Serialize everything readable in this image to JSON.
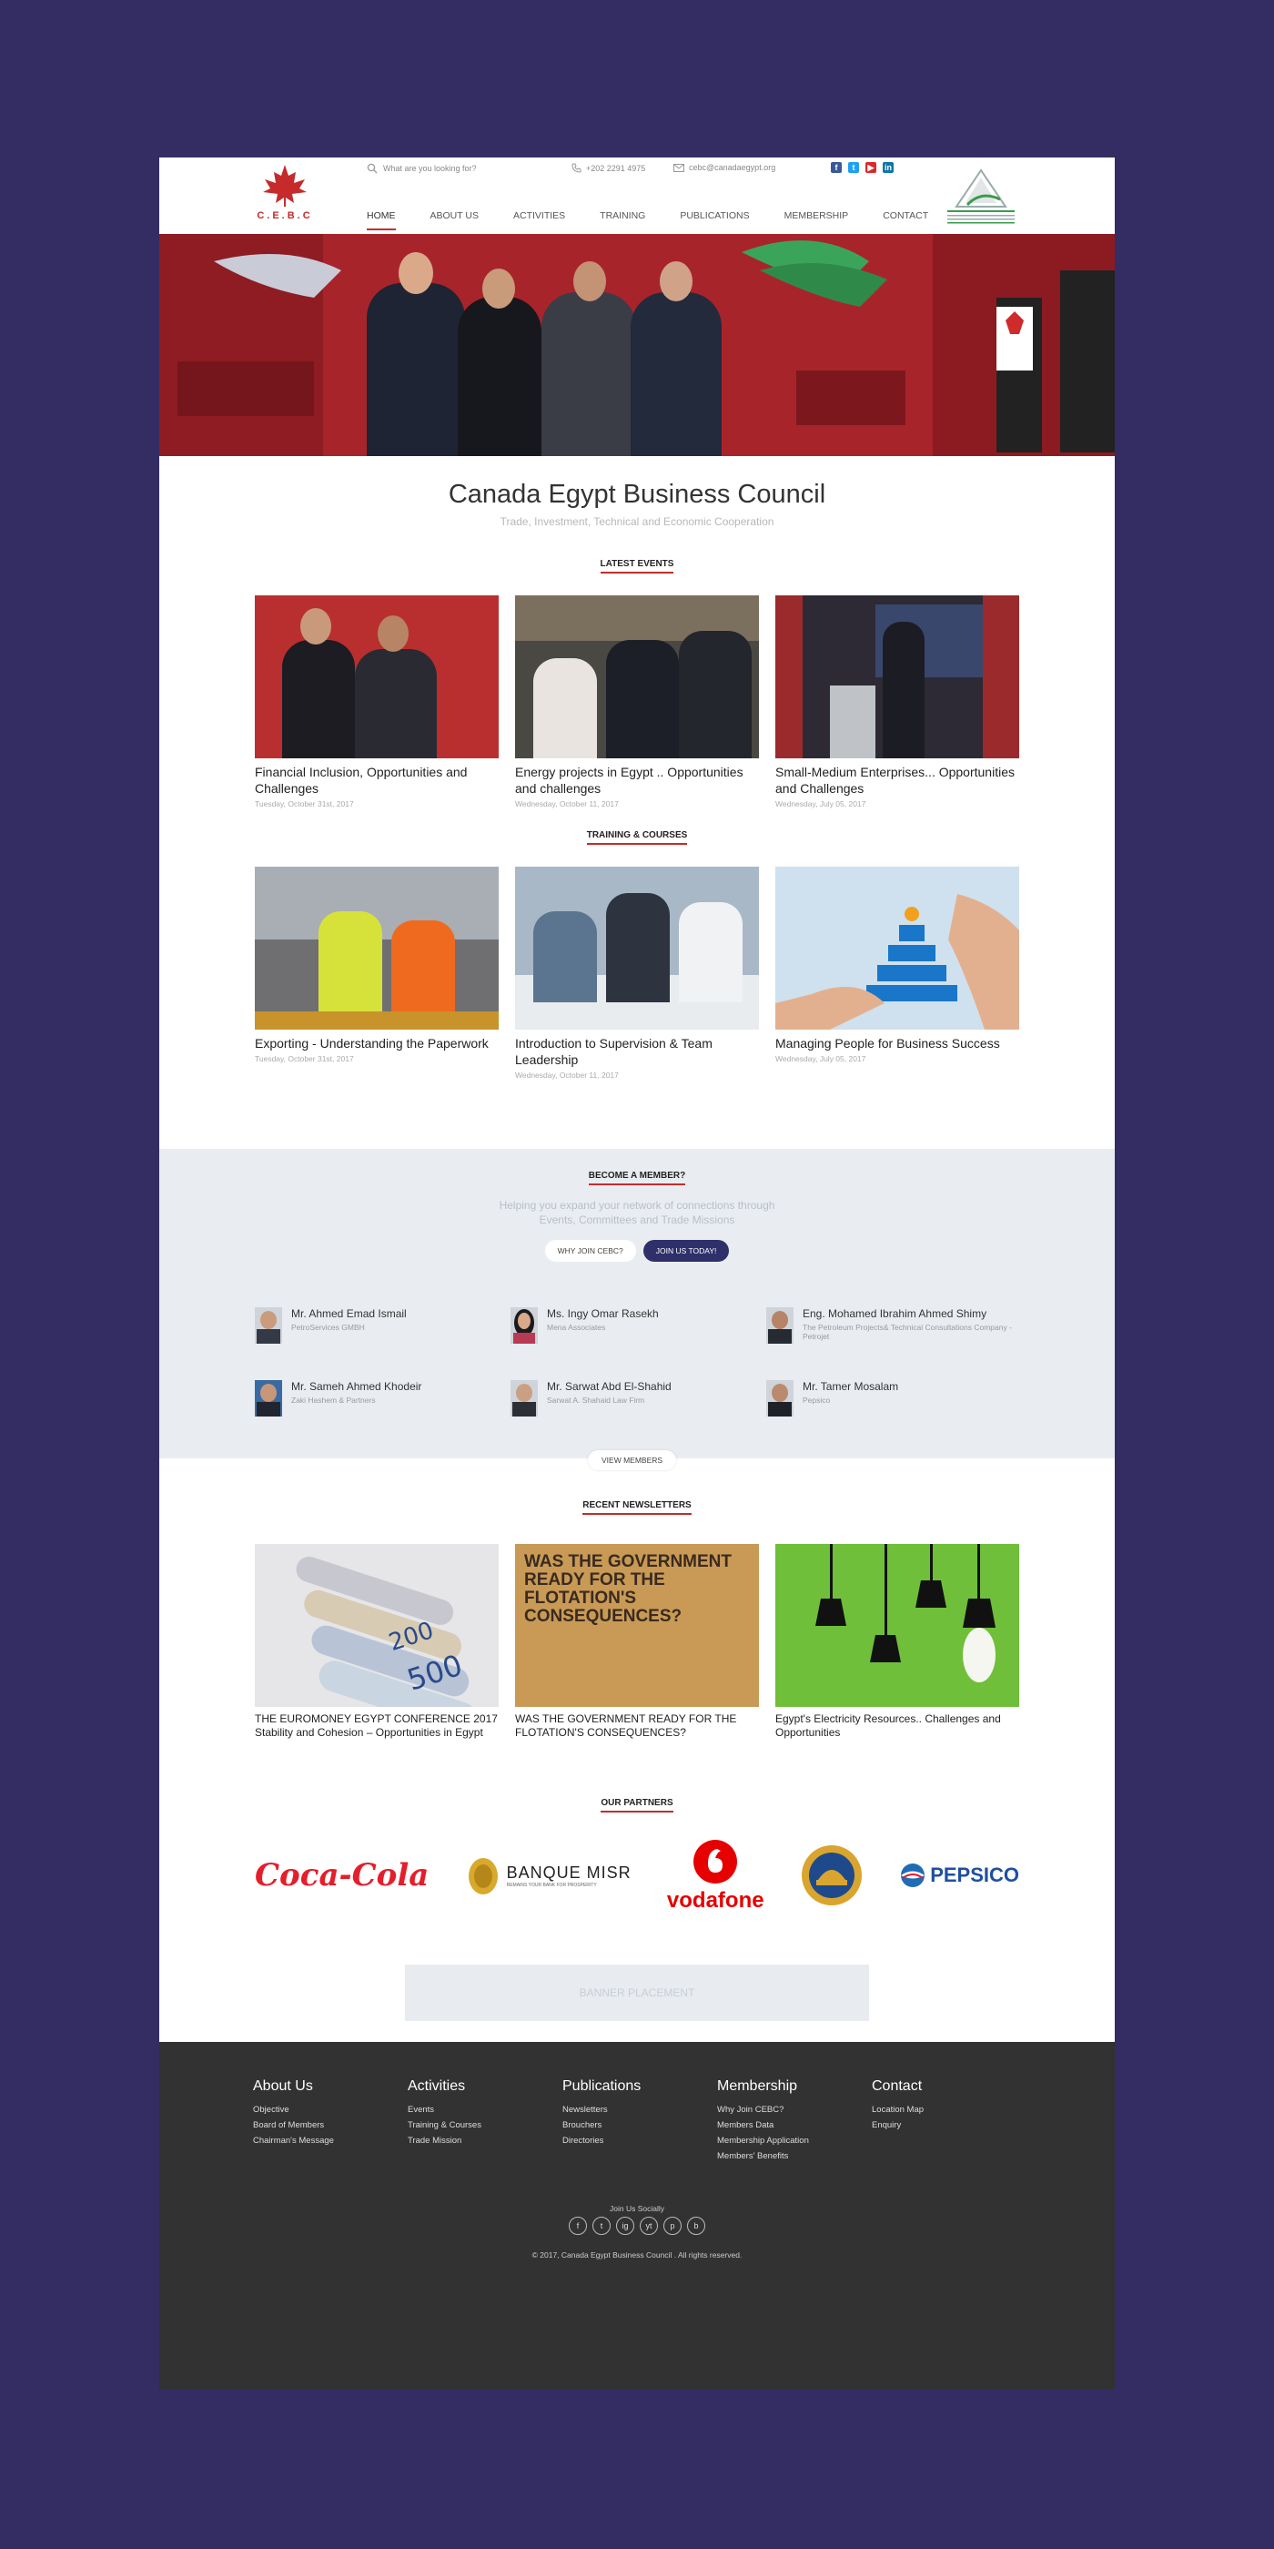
{
  "header": {
    "logo_text": "C.E.B.C",
    "search_placeholder": "What are you looking for?",
    "phone": "+202 2291 4975",
    "email": "cebc@canadaegypt.org",
    "social": [
      "facebook-icon",
      "twitter-icon",
      "youtube-icon",
      "linkedin-icon"
    ],
    "nav": [
      "HOME",
      "ABOUT US",
      "ACTIVITIES",
      "TRAINING",
      "PUBLICATIONS",
      "MEMBERSHIP",
      "CONTACT"
    ],
    "active_nav": "HOME",
    "accent": "#c62b2b"
  },
  "intro": {
    "title": "Canada Egypt Business Council",
    "subtitle": "Trade, Investment, Technical and Economic Cooperation"
  },
  "events": {
    "title": "LATEST EVENTS",
    "items": [
      {
        "title": "Financial Inclusion, Opportunities and Challenges",
        "date": "Tuesday, October 31st, 2017"
      },
      {
        "title": "Energy projects in Egypt .. Opportunities and challenges",
        "date": "Wednesday, October 11, 2017"
      },
      {
        "title": "Small-Medium Enterprises... Opportunities and Challenges",
        "date": "Wednesday, July 05, 2017"
      }
    ]
  },
  "training": {
    "title": "TRAINING & COURSES",
    "items": [
      {
        "title": "Exporting - Understanding the Paperwork",
        "date": "Tuesday, October 31st, 2017"
      },
      {
        "title": "Introduction to Supervision & Team Leadership",
        "date": "Wednesday, October 11, 2017"
      },
      {
        "title": "Managing People for Business Success",
        "date": "Wednesday, July 05, 2017"
      }
    ]
  },
  "membership": {
    "title": "BECOME A MEMBER?",
    "subtitle_1": "Helping you expand your network of connections through",
    "subtitle_2": "Events, Committees and Trade Missions",
    "why_button": "WHY JOIN CEBC?",
    "join_button": "JOIN US TODAY!",
    "view_button": "VIEW MEMBERS",
    "members": [
      {
        "name": "Mr. Ahmed Emad Ismail",
        "company": "PetroServices GMBH"
      },
      {
        "name": "Ms. Ingy Omar Rasekh",
        "company": "Mena Associates"
      },
      {
        "name": "Eng. Mohamed Ibrahim Ahmed Shimy",
        "company": "The Petroleum Projects& Technical Consultations Company - Petrojet"
      },
      {
        "name": "Mr. Sameh Ahmed Khodeir",
        "company": "Zaki Hashem & Partners"
      },
      {
        "name": "Mr. Sarwat Abd El-Shahid",
        "company": "Sarwat A. Shahaid Law Firm"
      },
      {
        "name": "Mr. Tamer Mosalam",
        "company": "Pepsico"
      }
    ]
  },
  "newsletters": {
    "title": "RECENT NEWSLETTERS",
    "items": [
      {
        "title": "THE EUROMONEY EGYPT CONFERENCE 2017 Stability and Cohesion – Opportunities in Egypt"
      },
      {
        "title": "WAS THE GOVERNMENT READY FOR THE FLOTATION'S CONSEQUENCES?"
      },
      {
        "title": "Egypt's Electricity Resources.. Challenges and Opportunities"
      }
    ],
    "poster_text": "WAS THE GOVERNMENT READY FOR THE FLOTATION'S CONSEQUENCES?"
  },
  "partners": {
    "title": "OUR PARTNERS",
    "logos": [
      "Coca-Cola",
      "BANQUE MISR",
      "vodafone",
      "PEPSICO"
    ],
    "banque_misr_sub": "REMAINS YOUR BANK FOR PROSPERITY"
  },
  "banner": {
    "text": "BANNER PLACEMENT"
  },
  "footer": {
    "columns": [
      {
        "title": "About Us",
        "links": [
          "Objective",
          "Board of Members",
          "Chairman's Message"
        ]
      },
      {
        "title": "Activities",
        "links": [
          "Events",
          "Training & Courses",
          "Trade Mission"
        ]
      },
      {
        "title": "Publications",
        "links": [
          "Newsletters",
          "Brouchers",
          "Directories"
        ]
      },
      {
        "title": "Membership",
        "links": [
          "Why Join CEBC?",
          "Members Data",
          "Membership Application",
          "Members' Benefits"
        ]
      },
      {
        "title": "Contact",
        "links": [
          "Location Map",
          "Enquiry"
        ]
      }
    ],
    "join_text": "Join Us Socially",
    "social_icons": [
      "f",
      "t",
      "ig",
      "yt",
      "p",
      "b"
    ],
    "copyright": "© 2017, Canada Egypt Business Council . All rights reserved."
  }
}
